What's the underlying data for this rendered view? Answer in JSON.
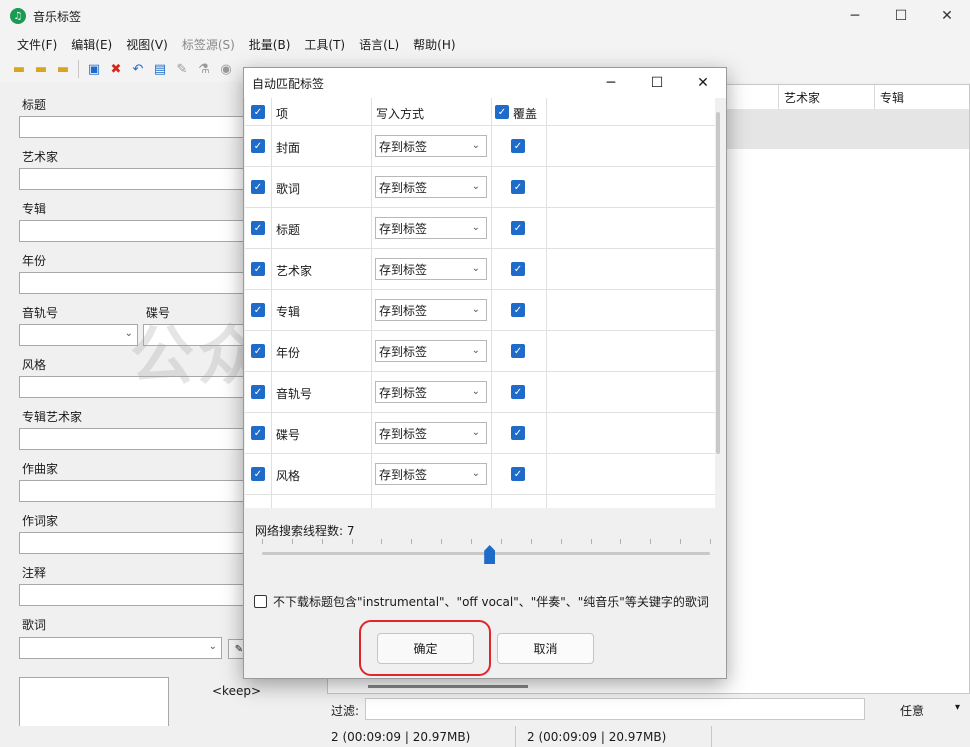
{
  "window": {
    "title": "音乐标签",
    "app_icon": "♫",
    "minimize": "─",
    "maximize": "☐",
    "close": "✕"
  },
  "menu": [
    "文件(F)",
    "编辑(E)",
    "视图(V)",
    "标签源(S)",
    "批量(B)",
    "工具(T)",
    "语言(L)",
    "帮助(H)"
  ],
  "toolbar_icons": [
    "folder-open-icon",
    "folder-add-icon",
    "folder-multi-icon",
    "save-icon",
    "delete-icon",
    "undo-icon",
    "book-icon",
    "wrench-icon",
    "filter-icon",
    "eye-icon"
  ],
  "left": {
    "labels": {
      "title": "标题",
      "artist": "艺术家",
      "album": "专辑",
      "year": "年份",
      "track": "音轨号",
      "disc": "碟号",
      "genre": "风格",
      "album_artist": "专辑艺术家",
      "composer": "作曲家",
      "lyricist": "作词家",
      "comment": "注释",
      "lyrics": "歌词"
    },
    "keep": "<keep>"
  },
  "list": {
    "col_artist": "艺术家",
    "col_album": "专辑"
  },
  "filter": {
    "label": "过滤:",
    "mode": "任意"
  },
  "status": {
    "left": "2 (00:09:09 | 20.97MB)",
    "right": "2 (00:09:09 | 20.97MB)"
  },
  "watermark": "公众号：酷酷的虎",
  "dialog": {
    "title": "自动匹配标签",
    "header": {
      "item": "项",
      "write_mode": "写入方式",
      "overwrite": "覆盖"
    },
    "rows": [
      {
        "item": "封面",
        "mode": "存到标签",
        "checked": true,
        "overwrite": true
      },
      {
        "item": "歌词",
        "mode": "存到标签",
        "checked": true,
        "overwrite": true
      },
      {
        "item": "标题",
        "mode": "存到标签",
        "checked": true,
        "overwrite": true
      },
      {
        "item": "艺术家",
        "mode": "存到标签",
        "checked": true,
        "overwrite": true
      },
      {
        "item": "专辑",
        "mode": "存到标签",
        "checked": true,
        "overwrite": true
      },
      {
        "item": "年份",
        "mode": "存到标签",
        "checked": true,
        "overwrite": true
      },
      {
        "item": "音轨号",
        "mode": "存到标签",
        "checked": true,
        "overwrite": true
      },
      {
        "item": "碟号",
        "mode": "存到标签",
        "checked": true,
        "overwrite": true
      },
      {
        "item": "风格",
        "mode": "存到标签",
        "checked": true,
        "overwrite": true
      }
    ],
    "threads_label": "网络搜索线程数: 7",
    "threads_value": 7,
    "threads_min": 1,
    "threads_max": 16,
    "option_text": "不下载标题包含\"instrumental\"、\"off vocal\"、\"伴奏\"、\"纯音乐\"等关键字的歌词",
    "option_checked": false,
    "ok": "确定",
    "cancel": "取消",
    "accent": "#1e6bc9",
    "highlight_color": "#e0262a"
  }
}
